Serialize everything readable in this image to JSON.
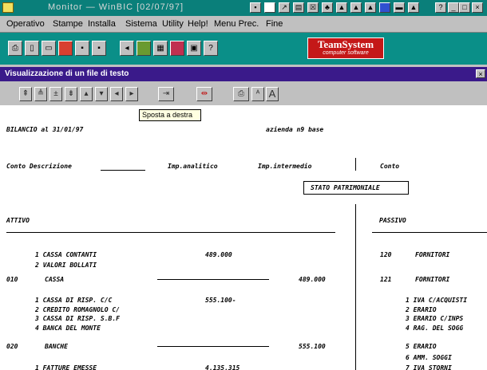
{
  "window": {
    "title": "Monitor  —  WinBIC [02/07/97]",
    "right_controls": [
      "?",
      "_",
      "□",
      "×"
    ]
  },
  "menu": [
    "Operativo",
    "Stampe",
    "Installa",
    "Sistema",
    "Utility",
    "Help!",
    "Menu Prec.",
    "Fine"
  ],
  "brand": {
    "name": "TeamSystem",
    "tagline": "computer software"
  },
  "doc_window": {
    "title": "Visualizzazione di un file di testo",
    "tooltip": "Sposta a destra"
  },
  "report": {
    "header": "BILANCIO al 31/01/97",
    "azienda": "azienda  n9 base",
    "columns": {
      "conto_desc": "Conto Descrizione",
      "imp_analitico": "Imp.analitico",
      "imp_intermedio": "Imp.intermedio",
      "conto": "Conto"
    },
    "section_title": "STATO PATRIMONIALE",
    "attivo": "ATTIVO",
    "passivo": "PASSIVO",
    "left_rows": [
      {
        "code": "",
        "text": "1 CASSA CONTANTI",
        "analitico": "489.000",
        "intermedio": ""
      },
      {
        "code": "",
        "text": "2 VALORI BOLLATI",
        "analitico": "",
        "intermedio": ""
      },
      {
        "code": "010",
        "text": "CASSA",
        "analitico": "",
        "intermedio": "489.000"
      },
      {
        "code": "",
        "text": "",
        "analitico": "",
        "intermedio": ""
      },
      {
        "code": "",
        "text": "1 CASSA DI RISP. C/C",
        "analitico": "555.100-",
        "intermedio": ""
      },
      {
        "code": "",
        "text": "2 CREDITO ROMAGNOLO C/",
        "analitico": "",
        "intermedio": ""
      },
      {
        "code": "",
        "text": "3 CASSA DI RISP. S.B.F",
        "analitico": "",
        "intermedio": ""
      },
      {
        "code": "",
        "text": "4 BANCA DEL MONTE",
        "analitico": "",
        "intermedio": ""
      },
      {
        "code": "020",
        "text": "BANCHE",
        "analitico": "",
        "intermedio": "555.100"
      },
      {
        "code": "",
        "text": "",
        "analitico": "",
        "intermedio": ""
      },
      {
        "code": "",
        "text": "1 FATTURE EMESSE",
        "analitico": "4.135.315",
        "intermedio": ""
      }
    ],
    "right_rows": [
      {
        "code": "120",
        "text": "FORNITORI"
      },
      {
        "code": "",
        "text": ""
      },
      {
        "code": "121",
        "text": "FORNITORI"
      },
      {
        "code": "",
        "text": ""
      },
      {
        "code": "",
        "text": "1 IVA C/ACQUISTI"
      },
      {
        "code": "",
        "text": "2 ERARIO"
      },
      {
        "code": "",
        "text": "3 ERARIO C/INPS"
      },
      {
        "code": "",
        "text": "4 RAG. DEL SOGG"
      },
      {
        "code": "",
        "text": "5 ERARIO"
      },
      {
        "code": "",
        "text": "6 AMM. SOGGI"
      },
      {
        "code": "",
        "text": "7 IVA STORNI"
      }
    ]
  }
}
